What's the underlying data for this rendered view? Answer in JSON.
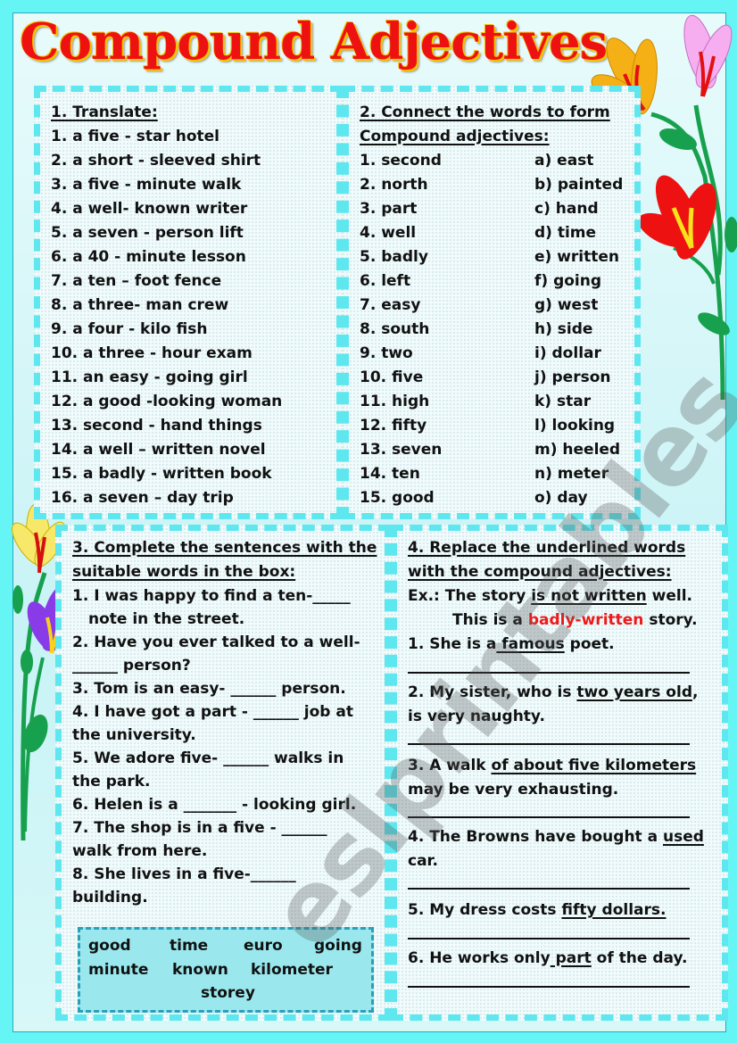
{
  "title": "Compound Adjectives",
  "watermark": "eslprintables.com",
  "colors": {
    "background": "#66f5f5",
    "title_red": "#ee1111",
    "title_outline": "#f7c500",
    "panel_border": "#5ee7ee",
    "example_red": "#ee1a1a"
  },
  "exercise1": {
    "heading": "1. Translate:",
    "items": [
      "1. a five - star hotel",
      "2. a short -  sleeved shirt",
      "3. a five - minute walk",
      "4. a well- known writer",
      "5. a seven - person lift",
      "6. a 40 - minute lesson",
      "7. a ten – foot fence",
      "8. a three- man crew",
      "9. a four - kilo fish",
      "10. a three - hour exam",
      "11. an easy - going girl",
      "12. a good -looking woman",
      "13. second - hand things",
      "14. a well – written novel",
      "15. a badly -  written book",
      "16. a seven – day trip"
    ]
  },
  "exercise2": {
    "heading_line1": "2. Connect the words to form",
    "heading_line2": "Compound adjectives:",
    "left": [
      "1. second",
      "2. north",
      "3. part",
      "4. well",
      "5. badly",
      "6. left",
      "7. easy",
      "8. south",
      "9. two",
      "10. five",
      "11. high",
      "12. fifty",
      "13. seven",
      "14. ten",
      "15. good"
    ],
    "right": [
      "a) east",
      "b) painted",
      "c) hand",
      "d) time",
      "e) written",
      "f) going",
      "g) west",
      "h) side",
      "i) dollar",
      "j) person",
      "k) star",
      "l) looking",
      "m) heeled",
      "n) meter",
      "o) day"
    ]
  },
  "exercise3": {
    "heading_line1": "3. Complete the sentences with the",
    "heading_line2": "suitable words in the box:",
    "lines": [
      "1. I was happy to find a ten-_____",
      "   note in the street.",
      "2. Have you ever talked to a well-",
      "______ person?",
      "3. Tom is an easy- ______ person.",
      "4. I have got a part - ______ job at",
      "the university.",
      "5. We adore five- ______ walks in",
      "the park.",
      "6. Helen is a _______ - looking girl.",
      "7. The shop is in a five - ______",
      "walk from here.",
      "8. She lives in a five-______",
      "building."
    ],
    "word_box": [
      "good",
      "time",
      "euro",
      "going",
      "minute",
      "known",
      "kilometer",
      "storey"
    ]
  },
  "exercise4": {
    "heading_line1": "4. Replace the underlined words",
    "heading_line2": "with the compound adjectives:",
    "example": {
      "prefix": "Ex.: The story ",
      "underlined": "is not written",
      "suffix": " well.",
      "answer_prefix": "This is a ",
      "answer_red": "badly-written",
      "answer_suffix": " story."
    },
    "items": [
      {
        "pre": "1. She is a",
        "u": " famous",
        "post": " poet.",
        "cont": ""
      },
      {
        "pre": "2. My sister, who is ",
        "u": "two years old",
        "post": ",",
        "cont": "is very naughty."
      },
      {
        "pre": "3. A walk ",
        "u": "of about five kilometers",
        "post": "",
        "cont": "may be very exhausting."
      },
      {
        "pre": "4. The Browns have bought a ",
        "u": "used",
        "post": "",
        "cont": "car."
      },
      {
        "pre": "5. My dress costs ",
        "u": "fifty dollars.",
        "post": "",
        "cont": ""
      },
      {
        "pre": "6. He works only",
        "u": " part",
        "post": " of the day.",
        "cont": ""
      }
    ]
  }
}
